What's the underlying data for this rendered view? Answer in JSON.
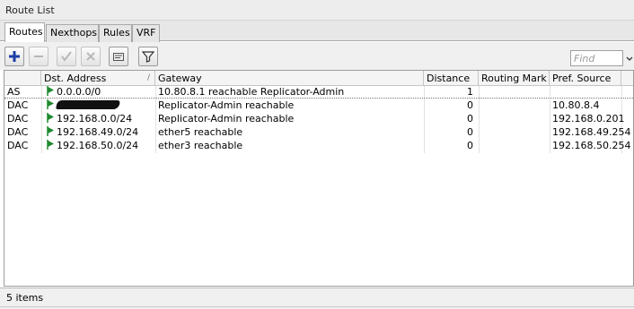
{
  "window": {
    "title": "Route List"
  },
  "tabs": [
    {
      "label": "Routes",
      "active": true
    },
    {
      "label": "Nexthops",
      "active": false
    },
    {
      "label": "Rules",
      "active": false
    },
    {
      "label": "VRF",
      "active": false
    }
  ],
  "toolbar": {
    "buttons": [
      {
        "name": "add-button",
        "icon": "plus-icon",
        "enabled": true
      },
      {
        "name": "remove-button",
        "icon": "minus-icon",
        "enabled": false
      },
      {
        "name": "enable-button",
        "icon": "check-icon",
        "enabled": false
      },
      {
        "name": "disable-button",
        "icon": "x-icon",
        "enabled": false
      },
      {
        "name": "comment-button",
        "icon": "note-icon",
        "enabled": true
      },
      {
        "name": "filter-button",
        "icon": "funnel-icon",
        "enabled": true
      }
    ],
    "find_placeholder": "Find"
  },
  "table": {
    "columns": [
      "",
      "Dst. Address",
      "Gateway",
      "Distance",
      "Routing Mark",
      "Pref. Source"
    ],
    "sort_indicator": "/",
    "rows": [
      {
        "flags": "AS",
        "dst": "0.0.0.0/0",
        "dst_redacted": false,
        "gateway": "10.80.8.1 reachable Replicator-Admin",
        "distance": "1",
        "routing_mark": "",
        "pref_source": ""
      },
      {
        "flags": "DAC",
        "dst": "",
        "dst_redacted": true,
        "gateway": "Replicator-Admin reachable",
        "distance": "0",
        "routing_mark": "",
        "pref_source": "10.80.8.4"
      },
      {
        "flags": "DAC",
        "dst": "192.168.0.0/24",
        "dst_redacted": false,
        "gateway": "Replicator-Admin reachable",
        "distance": "0",
        "routing_mark": "",
        "pref_source": "192.168.0.201"
      },
      {
        "flags": "DAC",
        "dst": "192.168.49.0/24",
        "dst_redacted": false,
        "gateway": "ether5 reachable",
        "distance": "0",
        "routing_mark": "",
        "pref_source": "192.168.49.254"
      },
      {
        "flags": "DAC",
        "dst": "192.168.50.0/24",
        "dst_redacted": false,
        "gateway": "ether3 reachable",
        "distance": "0",
        "routing_mark": "",
        "pref_source": "192.168.50.254"
      }
    ]
  },
  "status": {
    "items_text": "5 items"
  },
  "colors": {
    "flag_green": "#1e8a2e",
    "add_blue": "#1c3fa8"
  }
}
